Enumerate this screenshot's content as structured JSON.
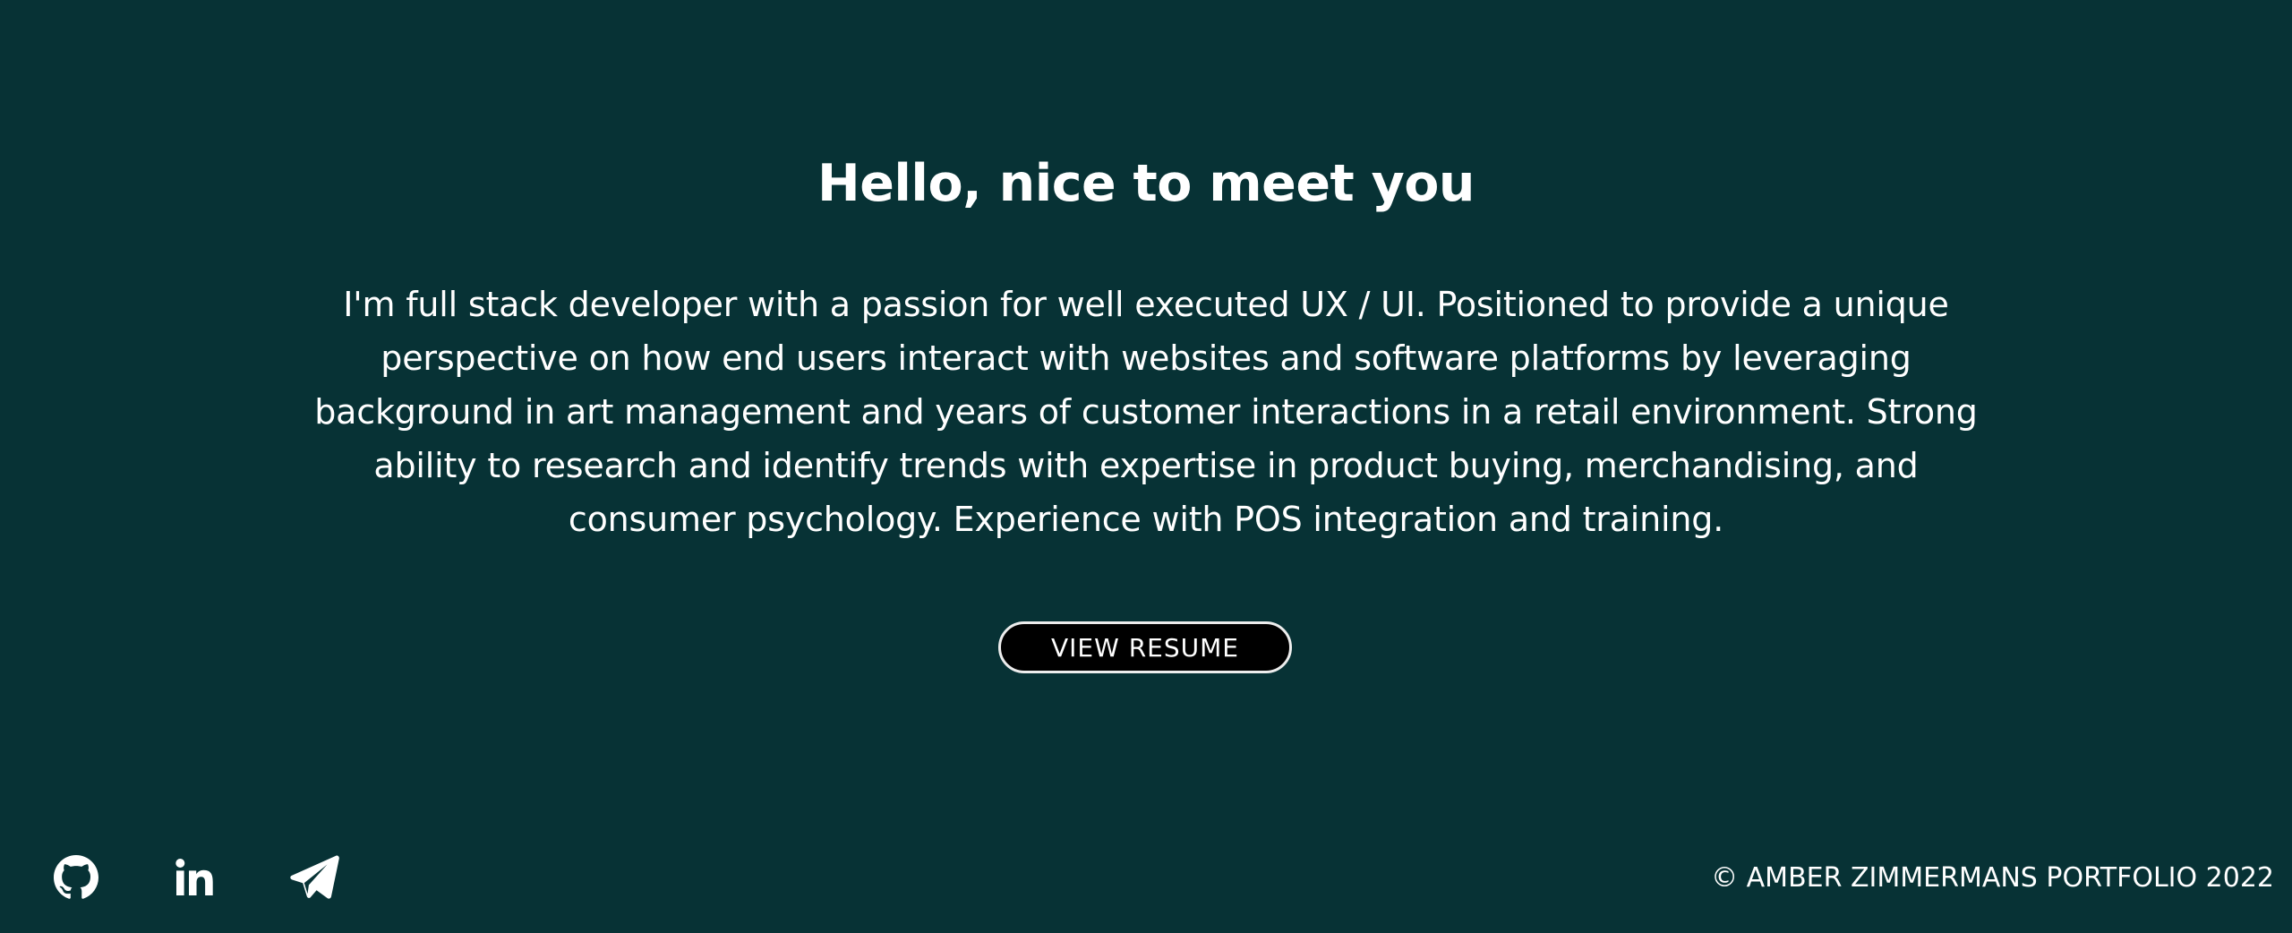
{
  "hero": {
    "title": "Hello, nice to meet you",
    "about": "I'm full stack developer with a passion for well executed UX / UI. Positioned to provide a unique perspective on how end users interact with websites and software platforms by leveraging background in art management and years of customer interactions in a retail environment. Strong ability to research and identify trends with expertise in product buying, merchandising, and consumer psychology. Experience with POS integration and training.",
    "resume_button_label": "VIEW RESUME"
  },
  "footer": {
    "social_icons": [
      "github-icon",
      "linkedin-icon",
      "telegram-icon"
    ],
    "copyright": "© AMBER ZIMMERMANS PORTFOLIO 2022"
  },
  "colors": {
    "background": "#073235",
    "text": "#ffffff",
    "button_background": "#000000",
    "button_border": "#ededed"
  }
}
